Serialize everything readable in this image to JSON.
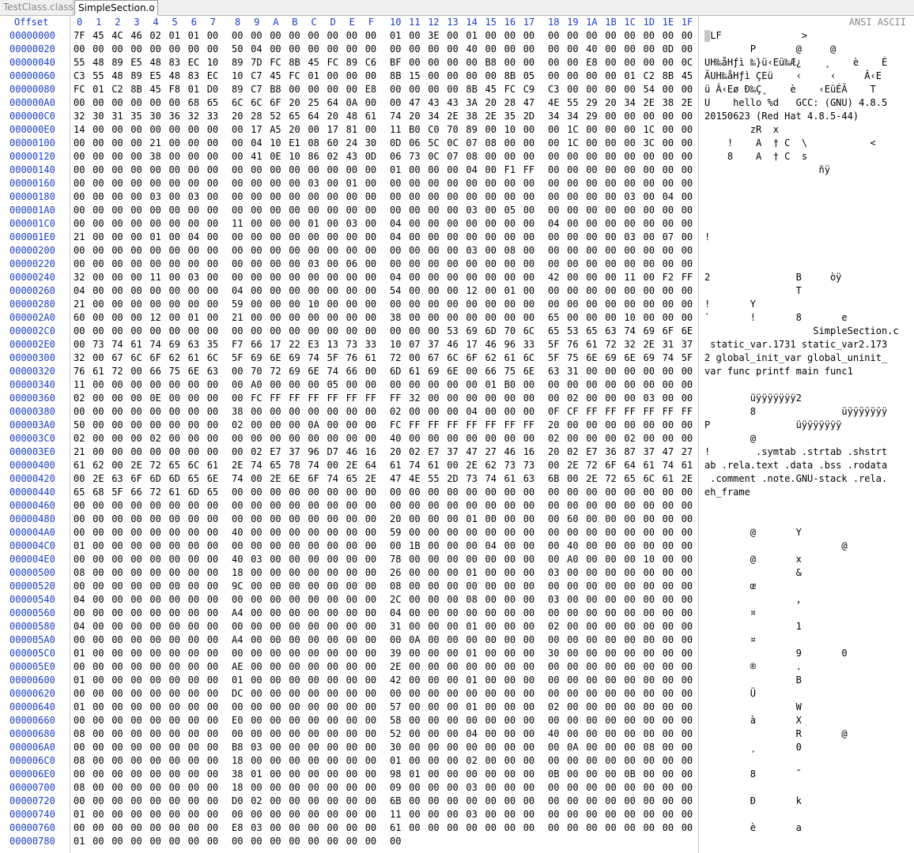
{
  "tabs": [
    {
      "label": "TestClass.class",
      "active": false
    },
    {
      "label": "SimpleSection.o",
      "active": true
    }
  ],
  "header": {
    "offset_label": "Offset",
    "columns": [
      "0",
      "1",
      "2",
      "3",
      "4",
      "5",
      "6",
      "7",
      "8",
      "9",
      "A",
      "B",
      "C",
      "D",
      "E",
      "F",
      "10",
      "11",
      "12",
      "13",
      "14",
      "15",
      "16",
      "17",
      "18",
      "19",
      "1A",
      "1B",
      "1C",
      "1D",
      "1E",
      "1F"
    ],
    "ascii_label": "ANSI ASCII"
  },
  "rows": [
    {
      "offset": "00000000",
      "hex": "7F454C4602010100000000000000000001003E0001000000000000000000000000",
      "ascii": "ELF              >"
    },
    {
      "offset": "00000020",
      "hex": "0000000000000000500400000000000000000000400000000000400000000D000C00",
      "ascii": "        P       @     @"
    },
    {
      "offset": "00000040",
      "hex": "554889E54883EC10897DFC8B45FC89C6BF00000000B800000000E8000000000C9",
      "ascii": "UH‰åHƒì ‰}ü‹Eü‰Æ¿    ¸    è    É"
    },
    {
      "offset": "00000060",
      "hex": "C3554889E54883EC10C745FC010000008B15000000008B050000000001C28B45",
      "ascii": "ÃUH‰åHƒì ÇEü    ‹     ‹     Â‹E"
    },
    {
      "offset": "00000080",
      "hex": "FC01C28B45F801D089C7B800000000E8000000008B45FCC9C3000000005400000000",
      "ascii": "ü Â‹Eø Ð‰Ç¸    è    ‹EüÉÃ    T"
    },
    {
      "offset": "000000A0",
      "hex": "00000000000068656C6C6F2025640A0000474343 3A20284 74E552920342E382E3520",
      "ascii": "U    hello %d   GCC: (GNU) 4.8.5"
    },
    {
      "offset": "000000C0",
      "hex": "3230313530363233202852656420486174 20342E382E352D3434290000000000",
      "ascii": "20150623 (Red Hat 4.8.5-44)"
    },
    {
      "offset": "000000E0",
      "hex": "14000000000000000017A5200017810011B0C07089001000001C0000001C000000",
      "ascii": "        zR  x"
    },
    {
      "offset": "00000100",
      "hex": "0000000021000000000410E1086024300D065C0C07080000001C0000003C000000",
      "ascii": "    !    A  † C  \\           <"
    },
    {
      "offset": "00000120",
      "hex": "000000003800000000410E10860243 0D06730C07080000000000000000000000",
      "ascii": "    8    A  † C  s"
    },
    {
      "offset": "00000140",
      "hex": "000000000000000000000000000000000100000004 00F1FF000000000000000000",
      "ascii": "                    ñÿ"
    },
    {
      "offset": "00000160",
      "hex": "000000000000000000000000030001000000000000000000000000000000000000",
      "ascii": ""
    },
    {
      "offset": "00000180",
      "hex": "000000000300030000000000000000000000000000000000000000000300040000",
      "ascii": ""
    },
    {
      "offset": "000001A0",
      "hex": "000000000000000000000000000000000000000003000500000000000000000000",
      "ascii": ""
    },
    {
      "offset": "000001C0",
      "hex": "000000000000000011000000010003000400000000000000040000000000000000",
      "ascii": ""
    },
    {
      "offset": "000001E0",
      "hex": "210000000100040000000000000000000400000000000000000000000300070000",
      "ascii": "!"
    },
    {
      "offset": "00000200",
      "hex": "000000000000000000000000000000000000000003000800000000000000000000",
      "ascii": ""
    },
    {
      "offset": "00000220",
      "hex": "000000000000000000000000030006000000000000000000000000000000000000",
      "ascii": ""
    },
    {
      "offset": "00000240",
      "hex": "32000000110003000000000000000000040000000000000042000000110 0F2FF",
      "ascii": "2               B     òÿ"
    },
    {
      "offset": "00000260",
      "hex": "040000000000000004000000000000005400000012000100000000000000000000",
      "ascii": "                T"
    },
    {
      "offset": "00000280",
      "hex": "210000000000000059000000100000000000000000000000000000000000000000",
      "ascii": "!       Y"
    },
    {
      "offset": "000002A0",
      "hex": "600000001200010021000000000000003800000000000000650000001000000000",
      "ascii": "`       !       8       e"
    },
    {
      "offset": "000002C0",
      "hex": "0000000000000000000000000000000000000053696D706C6553656374696F6E2E63",
      "ascii": "                   SimpleSection.c"
    },
    {
      "offset": "000002E0",
      "hex": "0073746174696335F7661722E313733310073746174696335F766172322E313733",
      "ascii": " static_var.1731 static_var2.173"
    },
    {
      "offset": "00000300",
      "hex": "3200676C6F62616C5F696E69745F7661720067 6C6F62616C5F756E696E69745F",
      "ascii": "2 global_init_var global_uninit_"
    },
    {
      "offset": "00000320",
      "hex": "7661720066756E63007072696E7466006D61696E0066756E633100000000000000",
      "ascii": "var func printf main func1"
    },
    {
      "offset": "00000340",
      "hex": "110000000000000000A0000000050000000000000001B00000000000000000000",
      "ascii": ""
    },
    {
      "offset": "00000360",
      "hex": "020000000E00000000FCFFFFFFFFFFFFFF3200000000000000020000000300000000",
      "ascii": "        üÿÿÿÿÿÿÿ2"
    },
    {
      "offset": "00000380",
      "hex": "0000000000000000380000000000000002000000040000000FCFFFFFFFFFFFFFF",
      "ascii": "        8               üÿÿÿÿÿÿÿ"
    },
    {
      "offset": "000003A0",
      "hex": "5000000000000000020000000A000000FCFFFFFFFFFFFFFF2000000000000000",
      "ascii": "P               üÿÿÿÿÿÿÿ"
    },
    {
      "offset": "000003C0",
      "hex": "020000000200000000000000000000004000000000000000020000000200000000",
      "ascii": "        @"
    },
    {
      "offset": "000003E0",
      "hex": "21000000000000000002E73796D746162002E737472746162002E736873747274",
      "ascii": "!        .symtab .strtab .shstrt"
    },
    {
      "offset": "00000400",
      "hex": "6162002E72656C612E74657874002E64617461002E627373002E726F64617461",
      "ascii": "ab .rela.text .data .bss .rodata"
    },
    {
      "offset": "00000420",
      "hex": "002E636F6D6D656E74002E6E6F74652E474E552D737461636B002E72656C612E",
      "ascii": " .comment .note.GNU-stack .rela."
    },
    {
      "offset": "00000440",
      "hex": "65685F6672616D650000000000000000000000000000000000000000000000000000",
      "ascii": "eh_frame"
    },
    {
      "offset": "00000460",
      "hex": "000000000000000000000000000000000000000000000000000000000000000000",
      "ascii": ""
    },
    {
      "offset": "00000480",
      "hex": "000000000000000000000000000000002000000001000000006000000000000000",
      "ascii": ""
    },
    {
      "offset": "000004A0",
      "hex": "000000000000000040000000000000005900000000000000000000000000000000",
      "ascii": "        @       Y"
    },
    {
      "offset": "000004C0",
      "hex": "01000000000000000000000000000000001B00000004000000400000000000000000",
      "ascii": "                        @"
    },
    {
      "offset": "000004E0",
      "hex": "00000000000000004003000000000000780000000000000000A000000010000000",
      "ascii": "        @       x"
    },
    {
      "offset": "00000500",
      "hex": "080000000000000018000000000000002600000001000000030000000000000000",
      "ascii": "                &"
    },
    {
      "offset": "00000520",
      "hex": "00000000000000009C000000000000000800000000000000000000000000000000",
      "ascii": "        œ"
    },
    {
      "offset": "00000540",
      "hex": "040000000000000000000000000000002C00000008000000030000000000000000",
      "ascii": "                ,"
    },
    {
      "offset": "00000560",
      "hex": "0000000000000000A4000000000000000400000000000000000000000000000000",
      "ascii": "        ¤"
    },
    {
      "offset": "00000580",
      "hex": "040000000000000000000000000000003100000001000000020000000000000000",
      "ascii": "                1"
    },
    {
      "offset": "000005A0",
      "hex": "0000000000000000A400000000000000000A000000000000000000000000000000",
      "ascii": "        ¤"
    },
    {
      "offset": "000005C0",
      "hex": "010000000000000000000000000000003900000001000000300000000000000000",
      "ascii": "                9       0"
    },
    {
      "offset": "000005E0",
      "hex": "0000000000000000AE000000000000002E00000000000000000000000000000000",
      "ascii": "        ®       ."
    },
    {
      "offset": "00000600",
      "hex": "010000000000000001000000000000004200000001000000000000000000000000",
      "ascii": "                B"
    },
    {
      "offset": "00000620",
      "hex": "0000000000000000DC000000000000000000000000000000000000000000000000",
      "ascii": "        Ü"
    },
    {
      "offset": "00000640",
      "hex": "010000000000000000000000000000005700000001000000020000000000000000",
      "ascii": "                W"
    },
    {
      "offset": "00000660",
      "hex": "0000000000000000E0000000000000005800000000000000000000000000000000",
      "ascii": "        à       X"
    },
    {
      "offset": "00000680",
      "hex": "080000000000000000000000000000005200000004000000400000000000000000",
      "ascii": "                R       @"
    },
    {
      "offset": "000006A0",
      "hex": "0000000000000000B8030000000000003000000000000000000A000000080000000",
      "ascii": "        ¸       0"
    },
    {
      "offset": "000006C0",
      "hex": "080000000000000018000000000000000100000002000000000000000000000000",
      "ascii": ""
    },
    {
      "offset": "000006E0",
      "hex": "0000000000000000380100000000000098010000000000000B0000000B00000000",
      "ascii": "        8       ˜"
    },
    {
      "offset": "00000700",
      "hex": "080000000000000018000000000000000900000003000000000000000000000000",
      "ascii": ""
    },
    {
      "offset": "00000720",
      "hex": "0000000000000000D0020000000000006B00000000000000000000000000000000",
      "ascii": "        Ð       k"
    },
    {
      "offset": "00000740",
      "hex": "010000000000000000000000000000001100000003000000000000000000000000",
      "ascii": ""
    },
    {
      "offset": "00000760",
      "hex": "0000000000000000E8030000000000006100000000000000000000000000000000",
      "ascii": "        è       a"
    },
    {
      "offset": "00000780",
      "hex": "0100000000000000000000000000000000",
      "ascii": ""
    }
  ]
}
